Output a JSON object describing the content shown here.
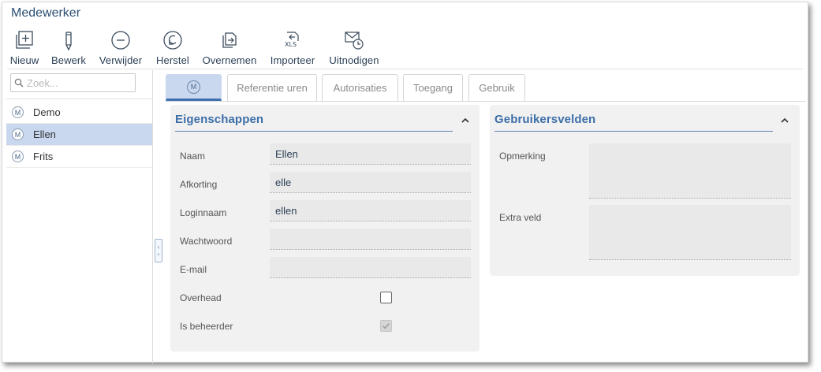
{
  "window": {
    "title": "Medewerker"
  },
  "toolbar": {
    "new_label": "Nieuw",
    "edit_label": "Bewerk",
    "delete_label": "Verwijder",
    "restore_label": "Herstel",
    "copy_label": "Overnemen",
    "import_label": "Importeer",
    "invite_label": "Uitnodigen",
    "import_icon_text": "XLS"
  },
  "search": {
    "placeholder": "Zoek...",
    "value": ""
  },
  "employees": [
    {
      "badge": "M",
      "name": "Demo",
      "selected": false
    },
    {
      "badge": "M",
      "name": "Ellen",
      "selected": true
    },
    {
      "badge": "M",
      "name": "Frits",
      "selected": false
    }
  ],
  "tabs": {
    "active_badge": "M",
    "reference_hours": "Referentie uren",
    "authorizations": "Autorisaties",
    "access": "Toegang",
    "usage": "Gebruik"
  },
  "properties": {
    "title": "Eigenschappen",
    "name_label": "Naam",
    "name_value": "Ellen",
    "abbrev_label": "Afkorting",
    "abbrev_value": "elle",
    "login_label": "Loginnaam",
    "login_value": "ellen",
    "password_label": "Wachtwoord",
    "password_value": "",
    "email_label": "E-mail",
    "email_value": "",
    "overhead_label": "Overhead",
    "overhead_checked": false,
    "admin_label": "Is beheerder",
    "admin_checked": true
  },
  "user_fields": {
    "title": "Gebruikersvelden",
    "remark_label": "Opmerking",
    "remark_value": "",
    "extra_label": "Extra veld",
    "extra_value": ""
  },
  "colors": {
    "accent": "#3d6ea8",
    "selected_bg": "#c9d8ef",
    "panel_bg": "#f1f1f1",
    "title_text": "#2b4f73"
  }
}
